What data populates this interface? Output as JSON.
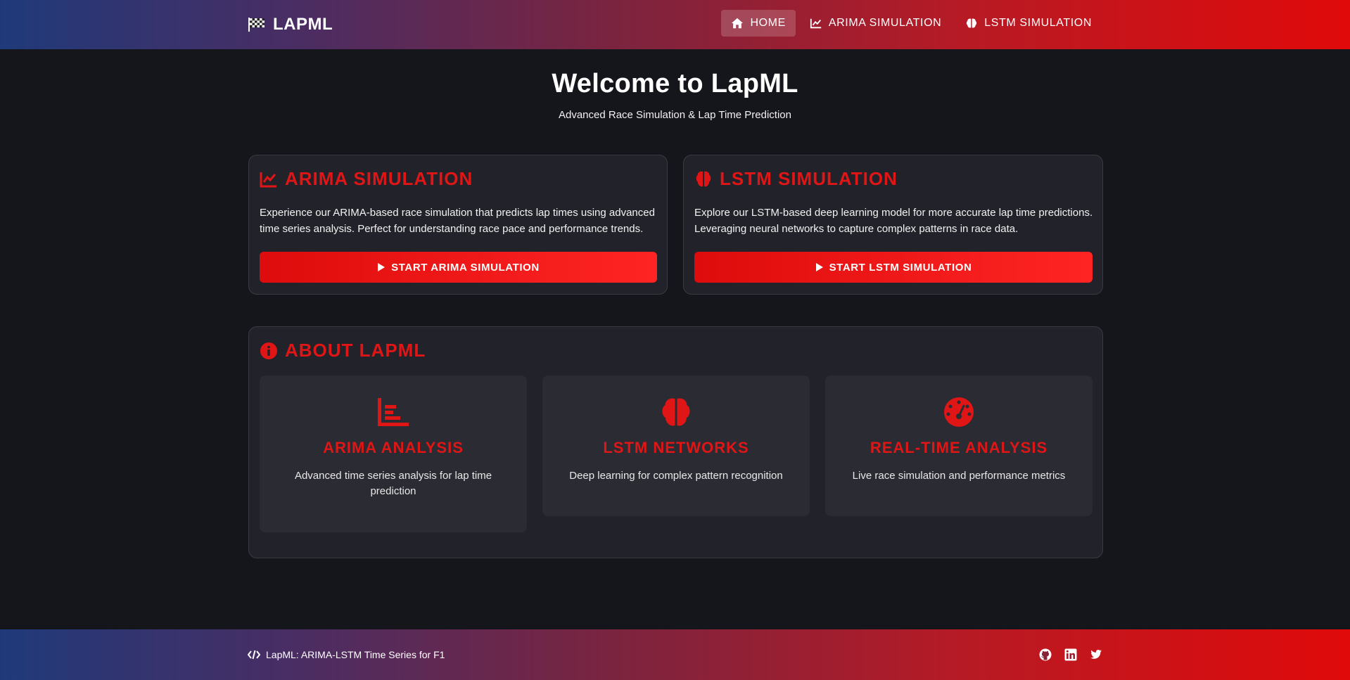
{
  "nav": {
    "brand": "LAPML",
    "links": [
      {
        "label": "HOME",
        "icon": "home-icon",
        "active": true
      },
      {
        "label": "ARIMA SIMULATION",
        "icon": "chart-line-icon",
        "active": false
      },
      {
        "label": "LSTM SIMULATION",
        "icon": "brain-icon",
        "active": false
      }
    ]
  },
  "hero": {
    "title": "Welcome to LapML",
    "subtitle": "Advanced Race Simulation & Lap Time Prediction"
  },
  "arima_card": {
    "title": "ARIMA SIMULATION",
    "text": "Experience our ARIMA-based race simulation that predicts lap times using advanced time series analysis. Perfect for understanding race pace and performance trends.",
    "button": "START ARIMA SIMULATION"
  },
  "lstm_card": {
    "title": "LSTM SIMULATION",
    "text": "Explore our LSTM-based deep learning model for more accurate lap time predictions. Leveraging neural networks to capture complex patterns in race data.",
    "button": "START LSTM SIMULATION"
  },
  "about": {
    "title": "ABOUT LAPML",
    "features": [
      {
        "icon": "bar-chart-icon",
        "title": "ARIMA ANALYSIS",
        "text": "Advanced time series analysis for lap time prediction"
      },
      {
        "icon": "brain-icon",
        "title": "LSTM NETWORKS",
        "text": "Deep learning for complex pattern recognition"
      },
      {
        "icon": "gauge-icon",
        "title": "REAL-TIME ANALYSIS",
        "text": "Live race simulation and performance metrics"
      }
    ]
  },
  "footer": {
    "text": "LapML: ARIMA-LSTM Time Series for F1",
    "socials": [
      "github-icon",
      "linkedin-icon",
      "twitter-icon"
    ]
  },
  "colors": {
    "accent": "#e01616",
    "background": "#15151c",
    "card": "#22222a",
    "feature_card": "#2b2b33",
    "gradient_start": "#1f3a7a",
    "gradient_end": "#e00a0a"
  }
}
